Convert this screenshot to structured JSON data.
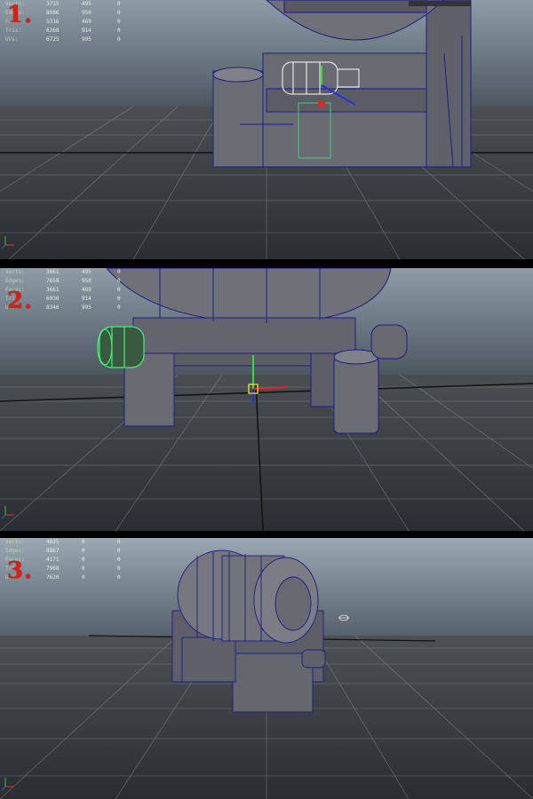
{
  "panels": [
    {
      "number": "1.",
      "stats": [
        {
          "label": "Verts:",
          "a": "3715",
          "b": "495",
          "c": "0"
        },
        {
          "label": "Edges:",
          "a": "8986",
          "b": "950",
          "c": "0"
        },
        {
          "label": "Faces:",
          "a": "5316",
          "b": "469",
          "c": "0"
        },
        {
          "label": "Tris:",
          "a": "6268",
          "b": "914",
          "c": "0"
        },
        {
          "label": "UVs:",
          "a": "6725",
          "b": "995",
          "c": "0"
        }
      ]
    },
    {
      "number": "2.",
      "stats": [
        {
          "label": "Verts:",
          "a": "3661",
          "b": "495",
          "c": "0"
        },
        {
          "label": "Edges:",
          "a": "7658",
          "b": "950",
          "c": "0"
        },
        {
          "label": "Faces:",
          "a": "3661",
          "b": "469",
          "c": "0"
        },
        {
          "label": "Tris:",
          "a": "6930",
          "b": "914",
          "c": "0"
        },
        {
          "label": "UVs:",
          "a": "8346",
          "b": "995",
          "c": "0"
        }
      ]
    },
    {
      "number": "3.",
      "stats": [
        {
          "label": "Verts:",
          "a": "4825",
          "b": "0",
          "c": "0"
        },
        {
          "label": "Edges:",
          "a": "8867",
          "b": "0",
          "c": "0"
        },
        {
          "label": "Faces:",
          "a": "4171",
          "b": "0",
          "c": "0"
        },
        {
          "label": "Tris:",
          "a": "7968",
          "b": "0",
          "c": "0"
        },
        {
          "label": "UVs:",
          "a": "7620",
          "b": "0",
          "c": "0"
        }
      ]
    }
  ],
  "colors": {
    "sky_top": "#94a2ae",
    "sky_bottom": "#5b6670",
    "ground": "#3a3d40",
    "grid": "#9aa0a4",
    "wire": "#1c1c8c",
    "model": "#6a6a70",
    "selected": "#46f07a",
    "number": "#e21b14"
  }
}
